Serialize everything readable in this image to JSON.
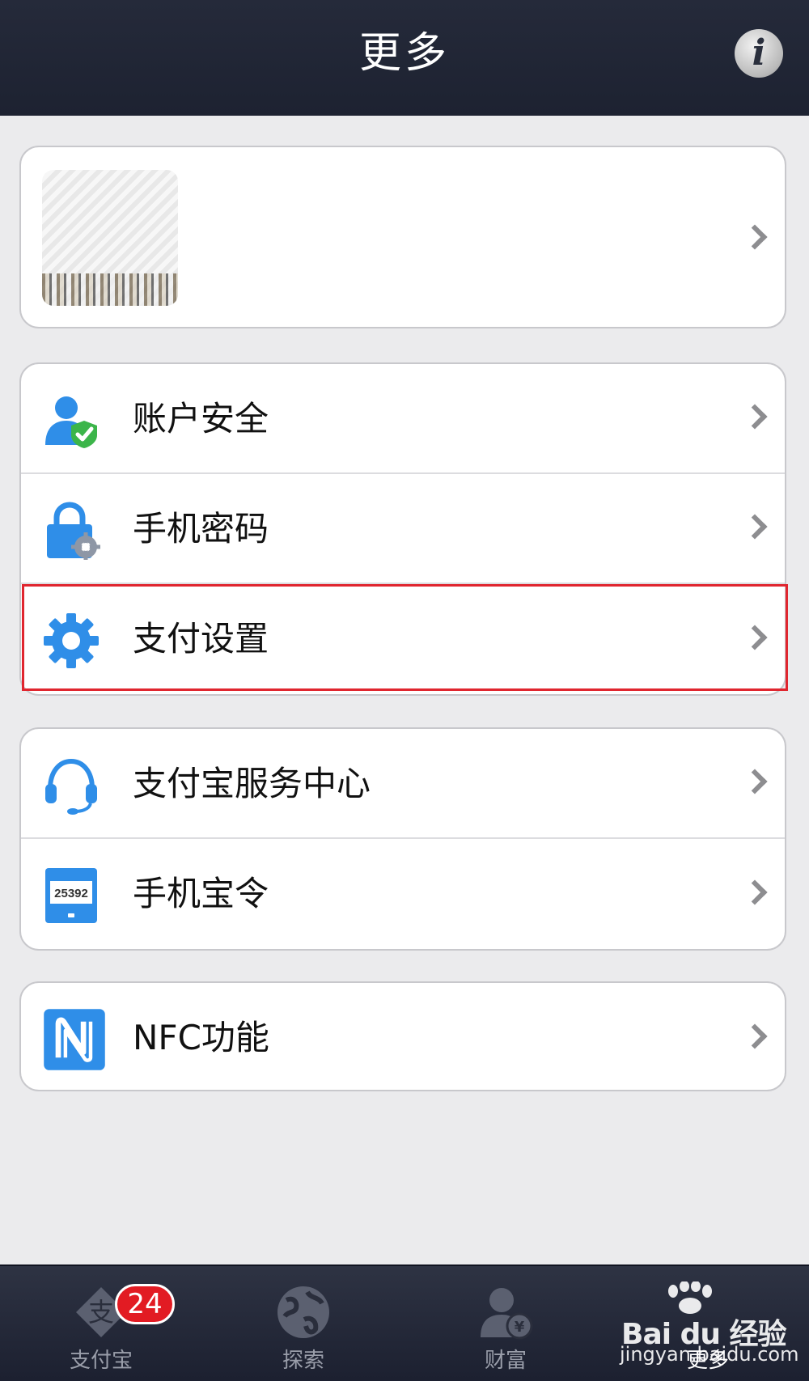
{
  "header": {
    "title": "更多",
    "info_icon": "info-icon"
  },
  "profile": {
    "avatar": "avatar-image",
    "name": ""
  },
  "menu_groups": [
    [
      {
        "label": "账户安全",
        "icon": "account-security-icon"
      },
      {
        "label": "手机密码",
        "icon": "phone-password-icon"
      },
      {
        "label": "支付设置",
        "icon": "payment-settings-gear-icon"
      }
    ],
    [
      {
        "label": "支付宝服务中心",
        "icon": "headset-icon"
      },
      {
        "label": "手机宝令",
        "icon": "token-device-icon",
        "icon_text": "25392"
      }
    ],
    [
      {
        "label": "NFC功能",
        "icon": "nfc-icon"
      }
    ]
  ],
  "tab_bar": {
    "tabs": [
      {
        "label": "支付宝",
        "icon": "alipay-logo-icon",
        "badge": "24",
        "icon_text": "支"
      },
      {
        "label": "探索",
        "icon": "globe-icon"
      },
      {
        "label": "财富",
        "icon": "wealth-user-icon",
        "icon_text": "¥"
      },
      {
        "label": "更多",
        "icon": "more-icon",
        "active": true
      }
    ]
  },
  "watermark": {
    "brand": "Bai du 经验",
    "site": "jingyan.baidu.com"
  },
  "colors": {
    "nav_bg": "#252a3a",
    "page_bg": "#ebebed",
    "accent_blue": "#2f8ee8",
    "highlight_red": "#e0262f",
    "badge_red": "#e21b23"
  }
}
